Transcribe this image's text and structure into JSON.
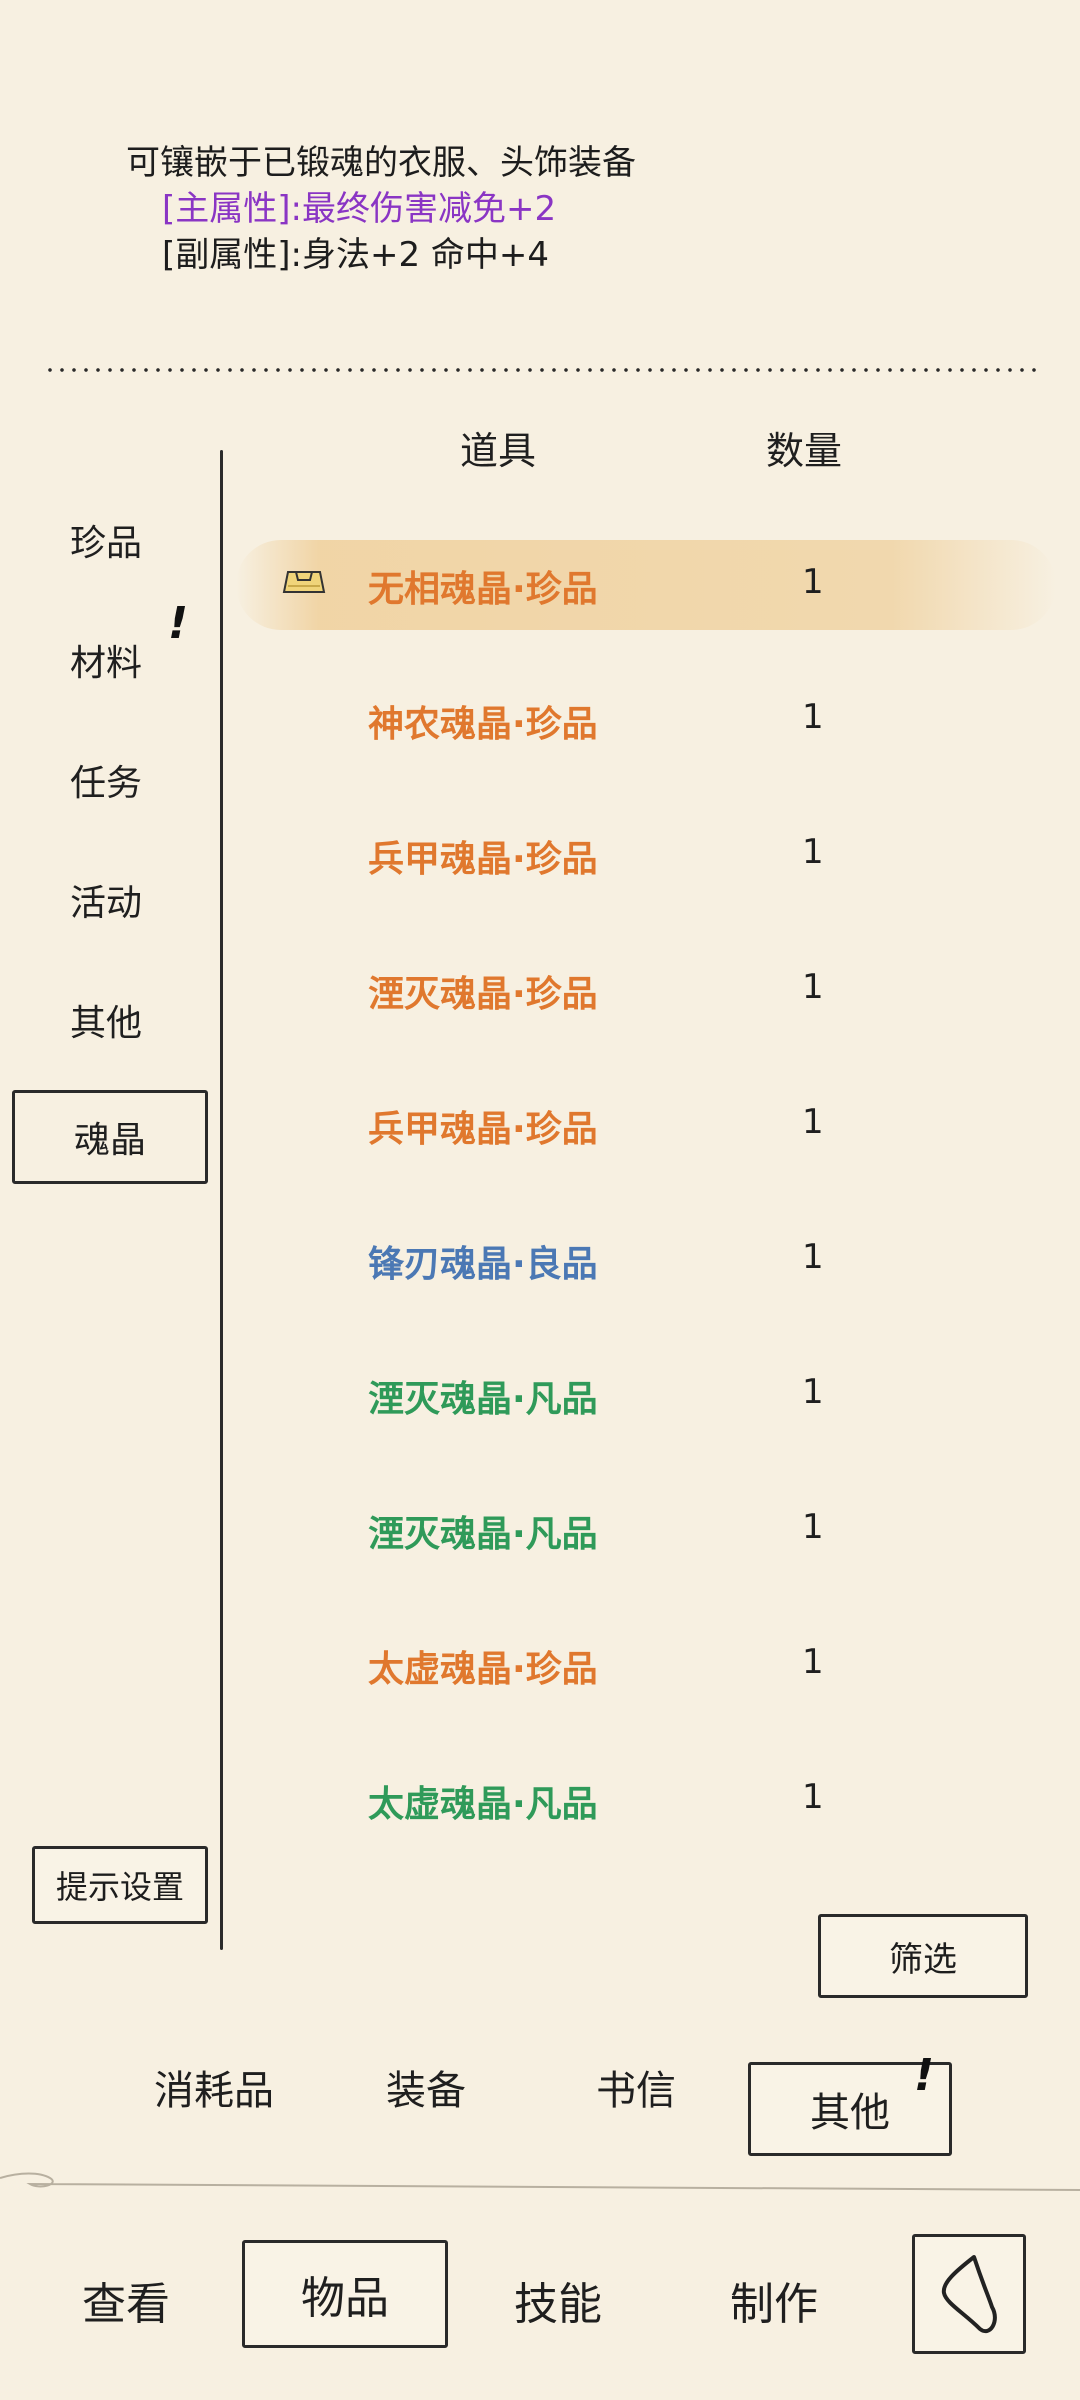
{
  "description": {
    "line1": "可镶嵌于已锻魂的衣服、头饰装备",
    "main_attr": "[主属性]:最终伤害减免+2",
    "sub_attr": "[副属性]:身法+2 命中+4"
  },
  "table_headers": {
    "item": "道具",
    "qty": "数量"
  },
  "categories": [
    {
      "label": "珍品"
    },
    {
      "label": "材料"
    },
    {
      "label": "任务"
    },
    {
      "label": "活动"
    },
    {
      "label": "其他"
    },
    {
      "label": "魂晶"
    }
  ],
  "alert_mark": "!",
  "items": [
    {
      "name": "无相魂晶·珍品",
      "qty": "1"
    },
    {
      "name": "神农魂晶·珍品",
      "qty": "1"
    },
    {
      "name": "兵甲魂晶·珍品",
      "qty": "1"
    },
    {
      "name": "湮灭魂晶·珍品",
      "qty": "1"
    },
    {
      "name": "兵甲魂晶·珍品",
      "qty": "1"
    },
    {
      "name": "锋刃魂晶·良品",
      "qty": "1"
    },
    {
      "name": "湮灭魂晶·凡品",
      "qty": "1"
    },
    {
      "name": "湮灭魂晶·凡品",
      "qty": "1"
    },
    {
      "name": "太虚魂晶·珍品",
      "qty": "1"
    },
    {
      "name": "太虚魂晶·凡品",
      "qty": "1"
    }
  ],
  "hint_settings": "提示设置",
  "filter": "筛选",
  "sub_tabs": [
    {
      "label": "消耗品"
    },
    {
      "label": "装备"
    },
    {
      "label": "书信"
    },
    {
      "label": "其他"
    }
  ],
  "main_nav": [
    {
      "label": "查看"
    },
    {
      "label": "物品"
    },
    {
      "label": "技能"
    },
    {
      "label": "制作"
    }
  ],
  "colors": {
    "rare": "#e0782e",
    "good": "#4b78b4",
    "common": "#2f9a59",
    "main_attr": "#8a35c4"
  },
  "icons": {
    "selected_item": "bag-icon",
    "back": "back-arrow-icon"
  }
}
